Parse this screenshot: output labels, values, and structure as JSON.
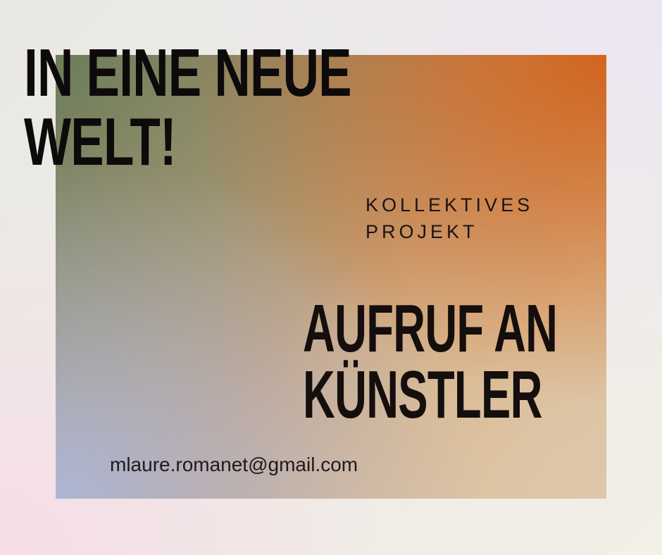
{
  "headline": {
    "line1": "IN EINE NEUE",
    "line2": "WELT!"
  },
  "subtitle": {
    "line1": "KOLLEKTIVES",
    "line2": "PROJEKT"
  },
  "call_to_action": {
    "line1": "AUFRUF AN",
    "line2": "KÜNSTLER"
  },
  "contact": {
    "email": "mlaure.romanet@gmail.com"
  },
  "colors": {
    "text_dark": "#0d0a0b",
    "accent_orange": "#d2651f",
    "accent_olive": "#6c7c5a",
    "accent_blue": "#aeb6d5"
  }
}
